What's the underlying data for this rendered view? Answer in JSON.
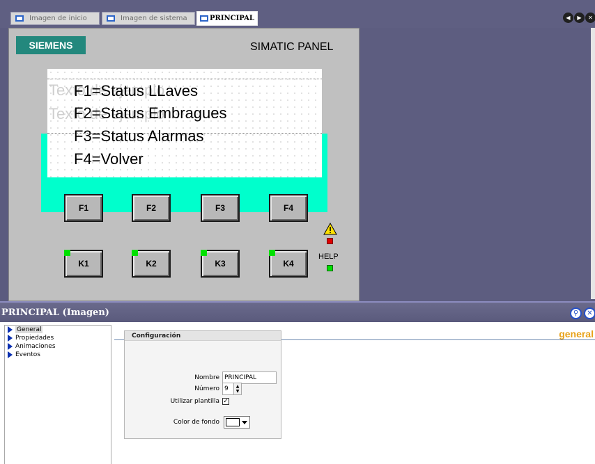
{
  "tabs": [
    {
      "label": "Imagen de inicio"
    },
    {
      "label": "Imagen de sistema"
    },
    {
      "label": "PRINCIPAL",
      "active": true
    }
  ],
  "nav": {
    "back_icon": "arrow-left-icon",
    "forward_icon": "arrow-right-icon",
    "close_icon": "close-icon"
  },
  "panel": {
    "logo": "SIEMENS",
    "title": "SIMATIC PANEL",
    "ghost_lines": [
      "Texto de ejemplo",
      "Texto de ejemplo"
    ],
    "menu_lines": [
      "F1=Status LLaves",
      "F2=Status Embragues",
      "F3=Status Alarmas",
      "F4=Volver"
    ],
    "function_keys": [
      "F1",
      "F2",
      "F3",
      "F4"
    ],
    "k_keys": [
      "K1",
      "K2",
      "K3",
      "K4"
    ],
    "help_label": "HELP",
    "colors": {
      "panel_bg": "#c0c0c0",
      "cyan": "#00ffcc",
      "logo": "#23887d",
      "led_green": "#00e000",
      "led_red": "#e00000"
    }
  },
  "properties": {
    "title": "PRINCIPAL (Imagen)",
    "header_icons": [
      "pin-icon",
      "close-icon"
    ],
    "sidebar": [
      {
        "label": "General",
        "selected": true
      },
      {
        "label": "Propiedades"
      },
      {
        "label": "Animaciones"
      },
      {
        "label": "Eventos"
      }
    ],
    "content_title": "general",
    "group_title": "Configuración",
    "fields": {
      "nombre_label": "Nombre",
      "nombre_value": "PRINCIPAL",
      "numero_label": "Número",
      "numero_value": "9",
      "plantilla_label": "Utilizar plantilla",
      "plantilla_checked": true,
      "color_label": "Color de fondo",
      "color_value": "#ffffff"
    }
  }
}
